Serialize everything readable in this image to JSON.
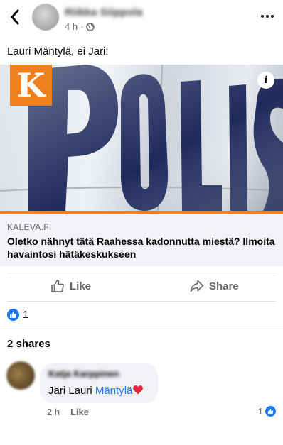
{
  "header": {
    "author_name": "Riikka Siippola",
    "time": "4 h",
    "privacy_icon": "globe-icon",
    "more_icon": "more-horizontal-icon"
  },
  "post": {
    "text": "Lauri Mäntylä, ei Jari!"
  },
  "link_card": {
    "logo_letter": "K",
    "image_text": "POLIS",
    "domain": "KALEVA.FI",
    "title": "Oletko nähnyt tätä Raahessa kadonnutta miestä? Ilmoita havaintosi hätäkeskukseen",
    "info_label": "i",
    "accent_color": "#f07f1f"
  },
  "actions": {
    "like_label": "Like",
    "share_label": "Share"
  },
  "reactions": {
    "count": "1"
  },
  "shares": {
    "label": "2 shares"
  },
  "comment": {
    "author": "Katja Karppinen",
    "text_prefix": "Jari Lauri ",
    "tag": "Mäntylä",
    "time": "2 h",
    "like_label": "Like",
    "reaction_count": "1"
  },
  "colors": {
    "facebook_blue": "#1877f2",
    "secondary_text": "#65676b",
    "divider": "#dadde1"
  }
}
